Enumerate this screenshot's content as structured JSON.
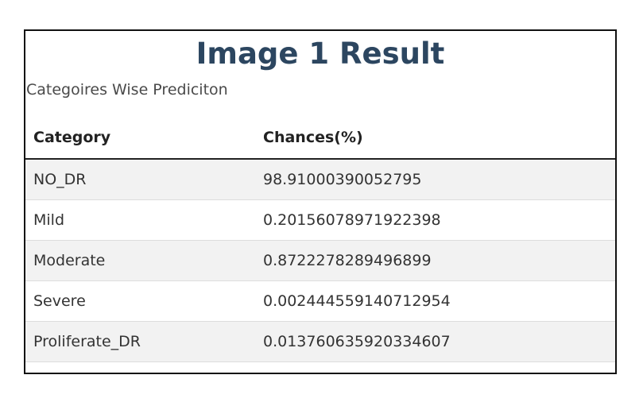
{
  "title": "Image 1 Result",
  "subtitle": "Categoires Wise Prediciton",
  "table": {
    "headers": [
      "Category",
      "Chances(%)"
    ],
    "rows": [
      {
        "category": "NO_DR",
        "chance": "98.91000390052795"
      },
      {
        "category": "Mild",
        "chance": "0.20156078971922398"
      },
      {
        "category": "Moderate",
        "chance": "0.8722278289496899"
      },
      {
        "category": "Severe",
        "chance": "0.002444559140712954"
      },
      {
        "category": "Proliferate_DR",
        "chance": "0.013760635920334607"
      }
    ]
  },
  "colors": {
    "title": "#2c4660",
    "border": "#111111",
    "row_alt": "#f2f2f2"
  }
}
